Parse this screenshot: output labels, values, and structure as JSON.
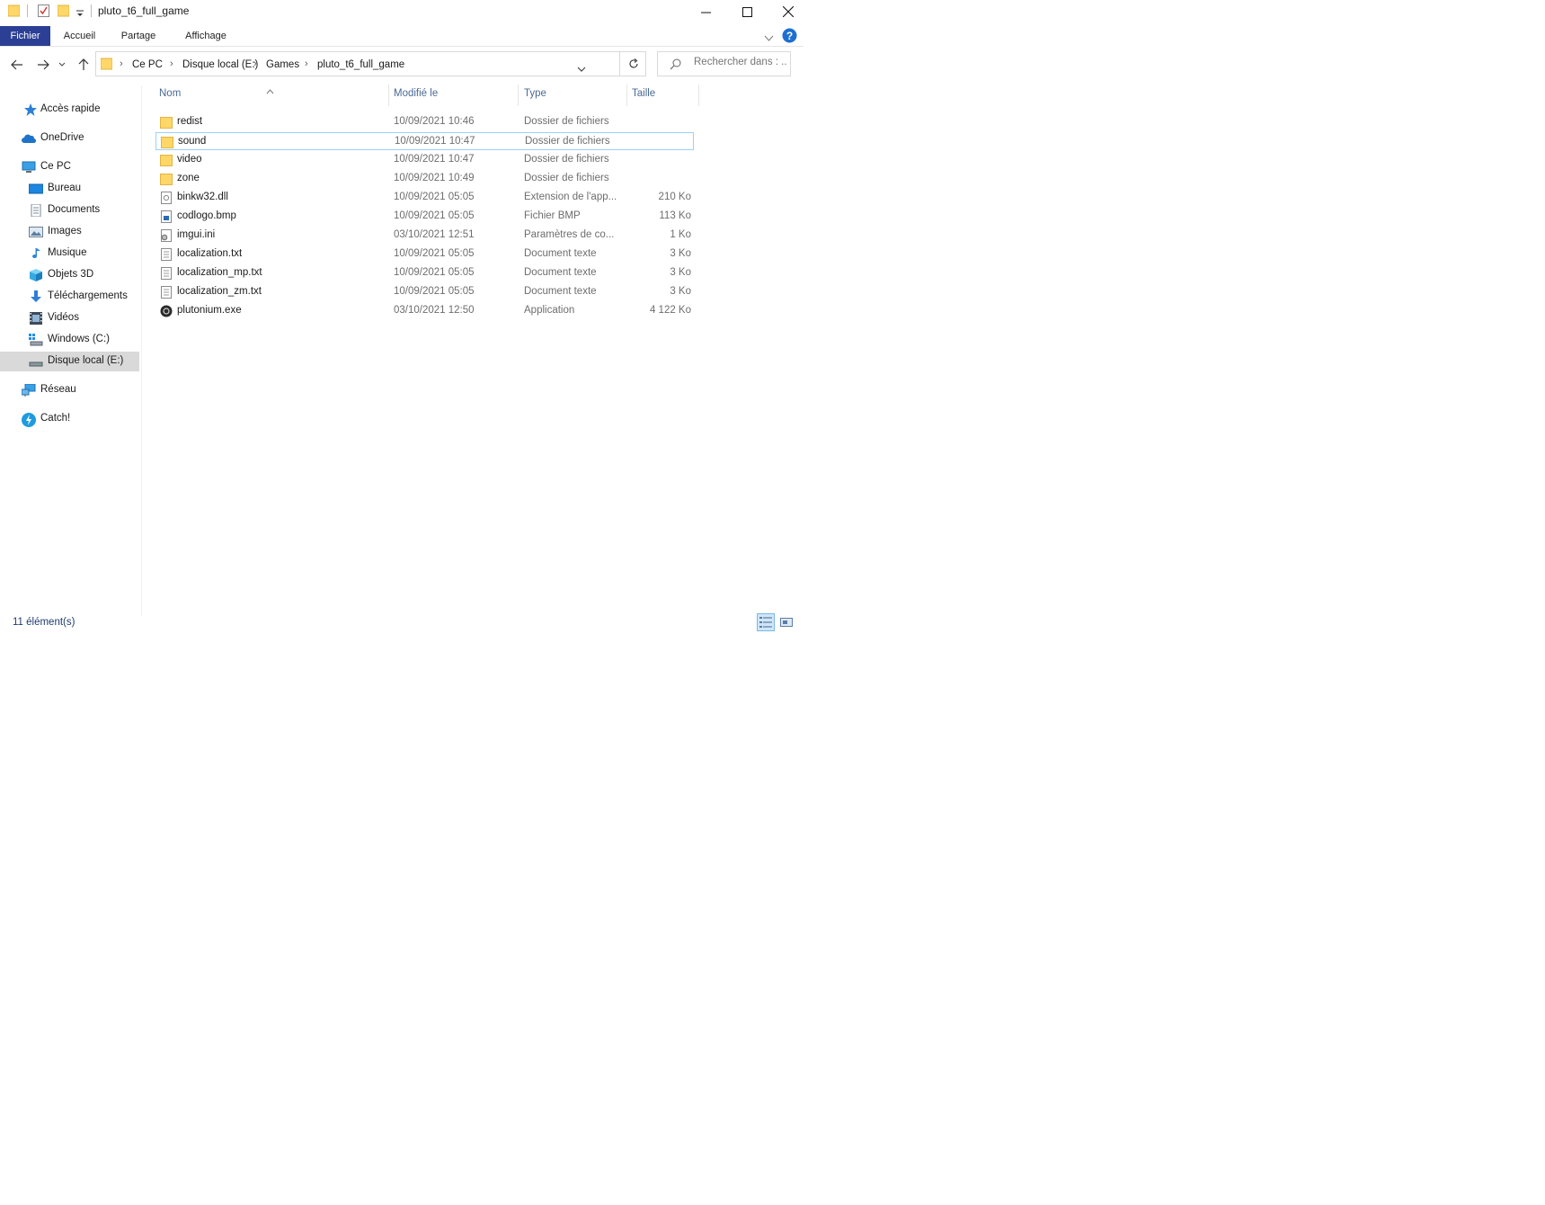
{
  "window": {
    "title": "pluto_t6_full_game"
  },
  "ribbon": {
    "tabs": [
      "Fichier",
      "Accueil",
      "Partage",
      "Affichage"
    ]
  },
  "address": {
    "crumbs": [
      "Ce PC",
      "Disque local (E:)",
      "Games",
      "pluto_t6_full_game"
    ]
  },
  "search": {
    "placeholder": "Rechercher dans : ..."
  },
  "sidebar": {
    "items": [
      {
        "label": "Accès rapide",
        "icon": "star-icon"
      },
      {
        "label": "OneDrive",
        "icon": "cloud-icon"
      },
      {
        "label": "Ce PC",
        "icon": "computer-icon"
      },
      {
        "label": "Bureau",
        "icon": "desktop-icon"
      },
      {
        "label": "Documents",
        "icon": "documents-icon"
      },
      {
        "label": "Images",
        "icon": "images-icon"
      },
      {
        "label": "Musique",
        "icon": "music-icon"
      },
      {
        "label": "Objets 3D",
        "icon": "cube-icon"
      },
      {
        "label": "Téléchargements",
        "icon": "download-icon"
      },
      {
        "label": "Vidéos",
        "icon": "video-icon"
      },
      {
        "label": "Windows (C:)",
        "icon": "drive-c-icon"
      },
      {
        "label": "Disque local (E:)",
        "icon": "drive-icon"
      },
      {
        "label": "Réseau",
        "icon": "network-icon"
      },
      {
        "label": "Catch!",
        "icon": "catch-icon"
      }
    ]
  },
  "columns": {
    "name": "Nom",
    "modified": "Modifié le",
    "type": "Type",
    "size": "Taille"
  },
  "files": [
    {
      "name": "redist",
      "modified": "10/09/2021 10:46",
      "type": "Dossier de fichiers",
      "size": "",
      "icon": "folder-icon"
    },
    {
      "name": "sound",
      "modified": "10/09/2021 10:47",
      "type": "Dossier de fichiers",
      "size": "",
      "icon": "folder-icon"
    },
    {
      "name": "video",
      "modified": "10/09/2021 10:47",
      "type": "Dossier de fichiers",
      "size": "",
      "icon": "folder-icon"
    },
    {
      "name": "zone",
      "modified": "10/09/2021 10:49",
      "type": "Dossier de fichiers",
      "size": "",
      "icon": "folder-icon"
    },
    {
      "name": "binkw32.dll",
      "modified": "10/09/2021 05:05",
      "type": "Extension de l'app...",
      "size": "210 Ko",
      "icon": "dll-icon"
    },
    {
      "name": "codlogo.bmp",
      "modified": "10/09/2021 05:05",
      "type": "Fichier BMP",
      "size": "113 Ko",
      "icon": "bmp-icon"
    },
    {
      "name": "imgui.ini",
      "modified": "03/10/2021 12:51",
      "type": "Paramètres de co...",
      "size": "1 Ko",
      "icon": "ini-icon"
    },
    {
      "name": "localization.txt",
      "modified": "10/09/2021 05:05",
      "type": "Document texte",
      "size": "3 Ko",
      "icon": "text-file-icon"
    },
    {
      "name": "localization_mp.txt",
      "modified": "10/09/2021 05:05",
      "type": "Document texte",
      "size": "3 Ko",
      "icon": "text-file-icon"
    },
    {
      "name": "localization_zm.txt",
      "modified": "10/09/2021 05:05",
      "type": "Document texte",
      "size": "3 Ko",
      "icon": "text-file-icon"
    },
    {
      "name": "plutonium.exe",
      "modified": "03/10/2021 12:50",
      "type": "Application",
      "size": "4 122 Ko",
      "icon": "plutonium-icon"
    }
  ],
  "status": {
    "count": "11 élément(s)"
  }
}
